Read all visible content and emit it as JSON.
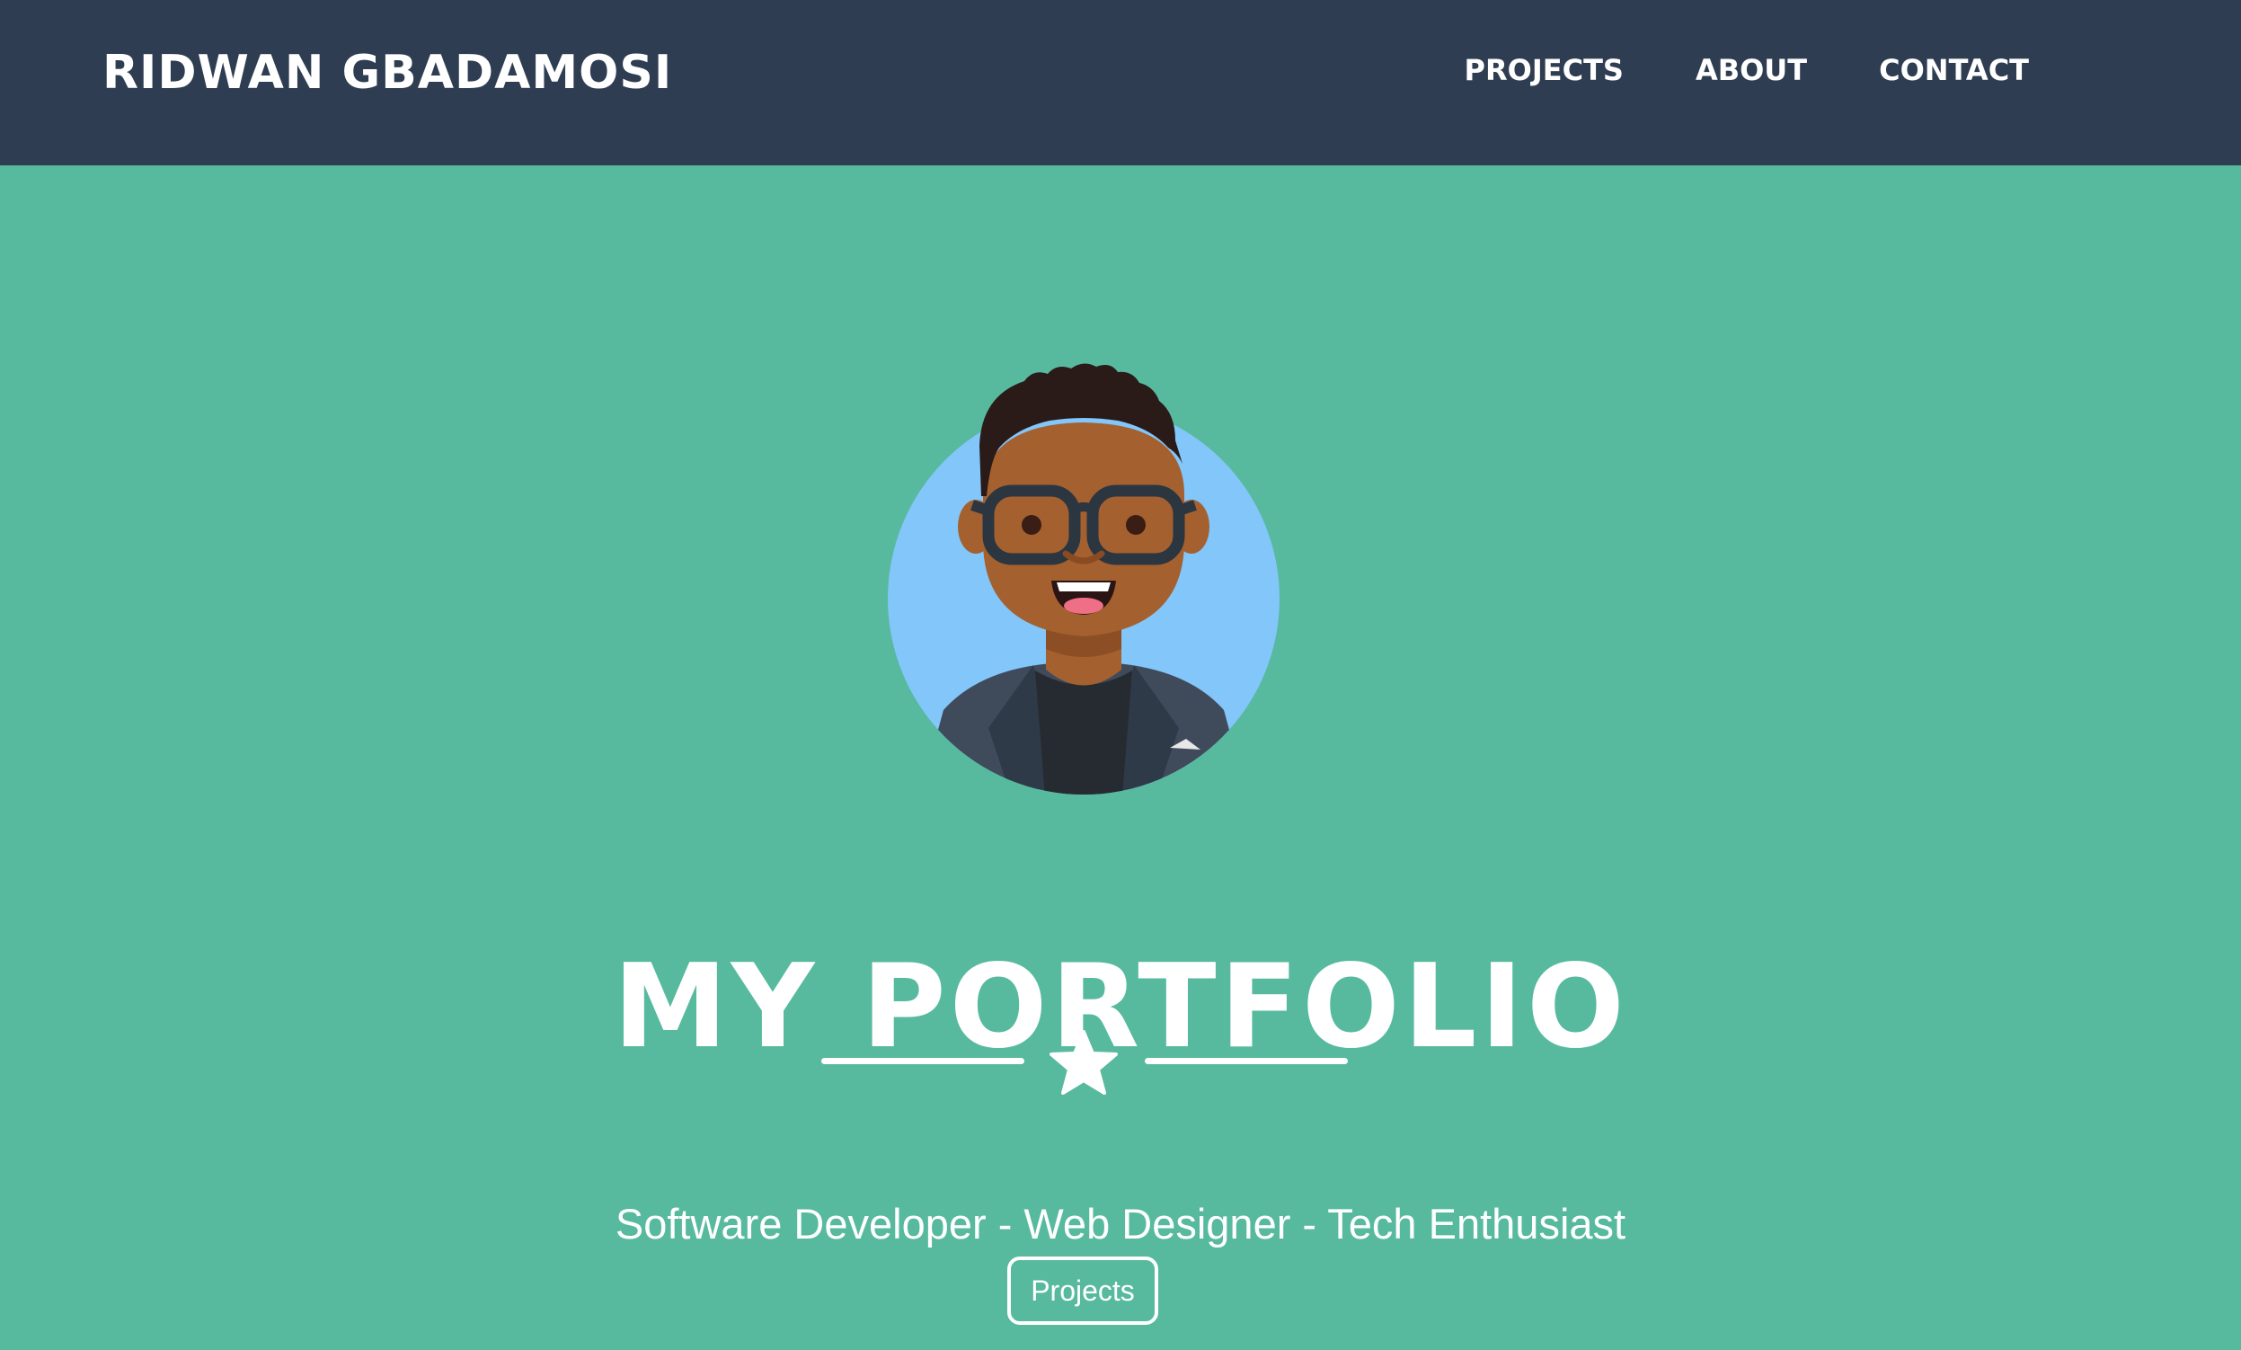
{
  "navbar": {
    "brand": "RIDWAN GBADAMOSI",
    "links": [
      {
        "label": "PROJECTS"
      },
      {
        "label": "ABOUT"
      },
      {
        "label": "CONTACT"
      }
    ],
    "background": "#2f3d52"
  },
  "hero": {
    "title": "MY PORTFOLIO",
    "divider_icon": "star-icon",
    "subtitle": "Software Developer - Web Designer - Tech Enthusiast",
    "button_label": "Projects",
    "background": "#57ba9e",
    "avatar_icon": "avatar-illustration"
  }
}
